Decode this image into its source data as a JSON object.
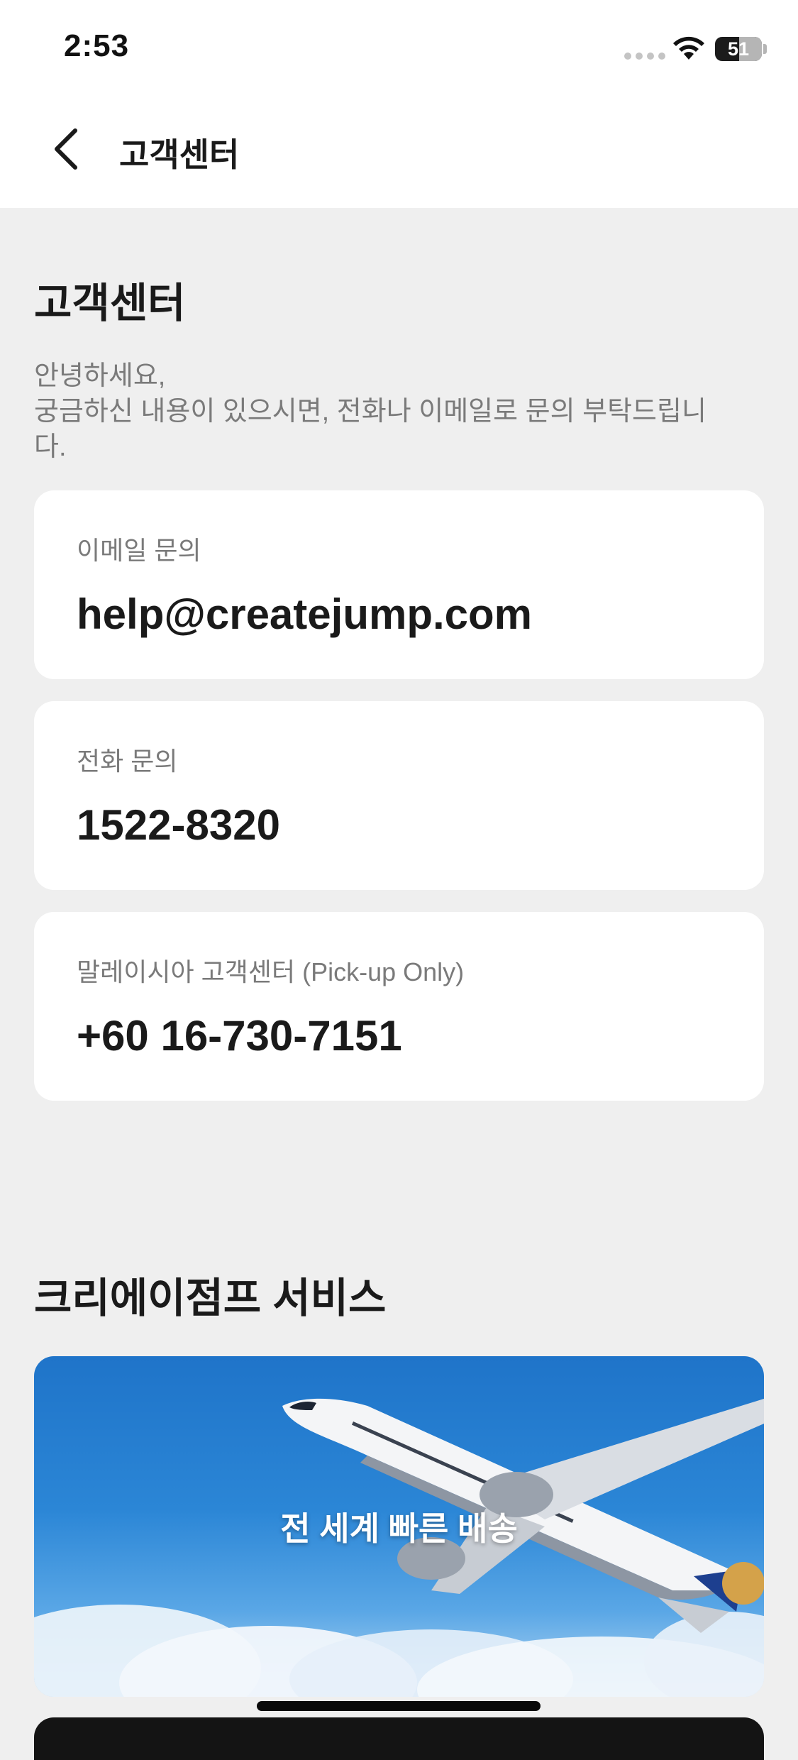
{
  "status_bar": {
    "time": "2:53",
    "battery": "51"
  },
  "nav": {
    "title": "고객센터"
  },
  "support": {
    "heading": "고객센터",
    "intro": "안녕하세요,\n궁금하신 내용이 있으시면, 전화나 이메일로 문의 부탁드립니\n다.",
    "cards": [
      {
        "label": "이메일 문의",
        "value": "help@createjump.com"
      },
      {
        "label": "전화 문의",
        "value": "1522-8320"
      },
      {
        "label": "말레이시아 고객센터 (Pick-up Only)",
        "value": "+60 16-730-7151"
      }
    ]
  },
  "services": {
    "heading": "크리에이점프 서비스",
    "banner_text": "전 세계 빠른 배송"
  }
}
